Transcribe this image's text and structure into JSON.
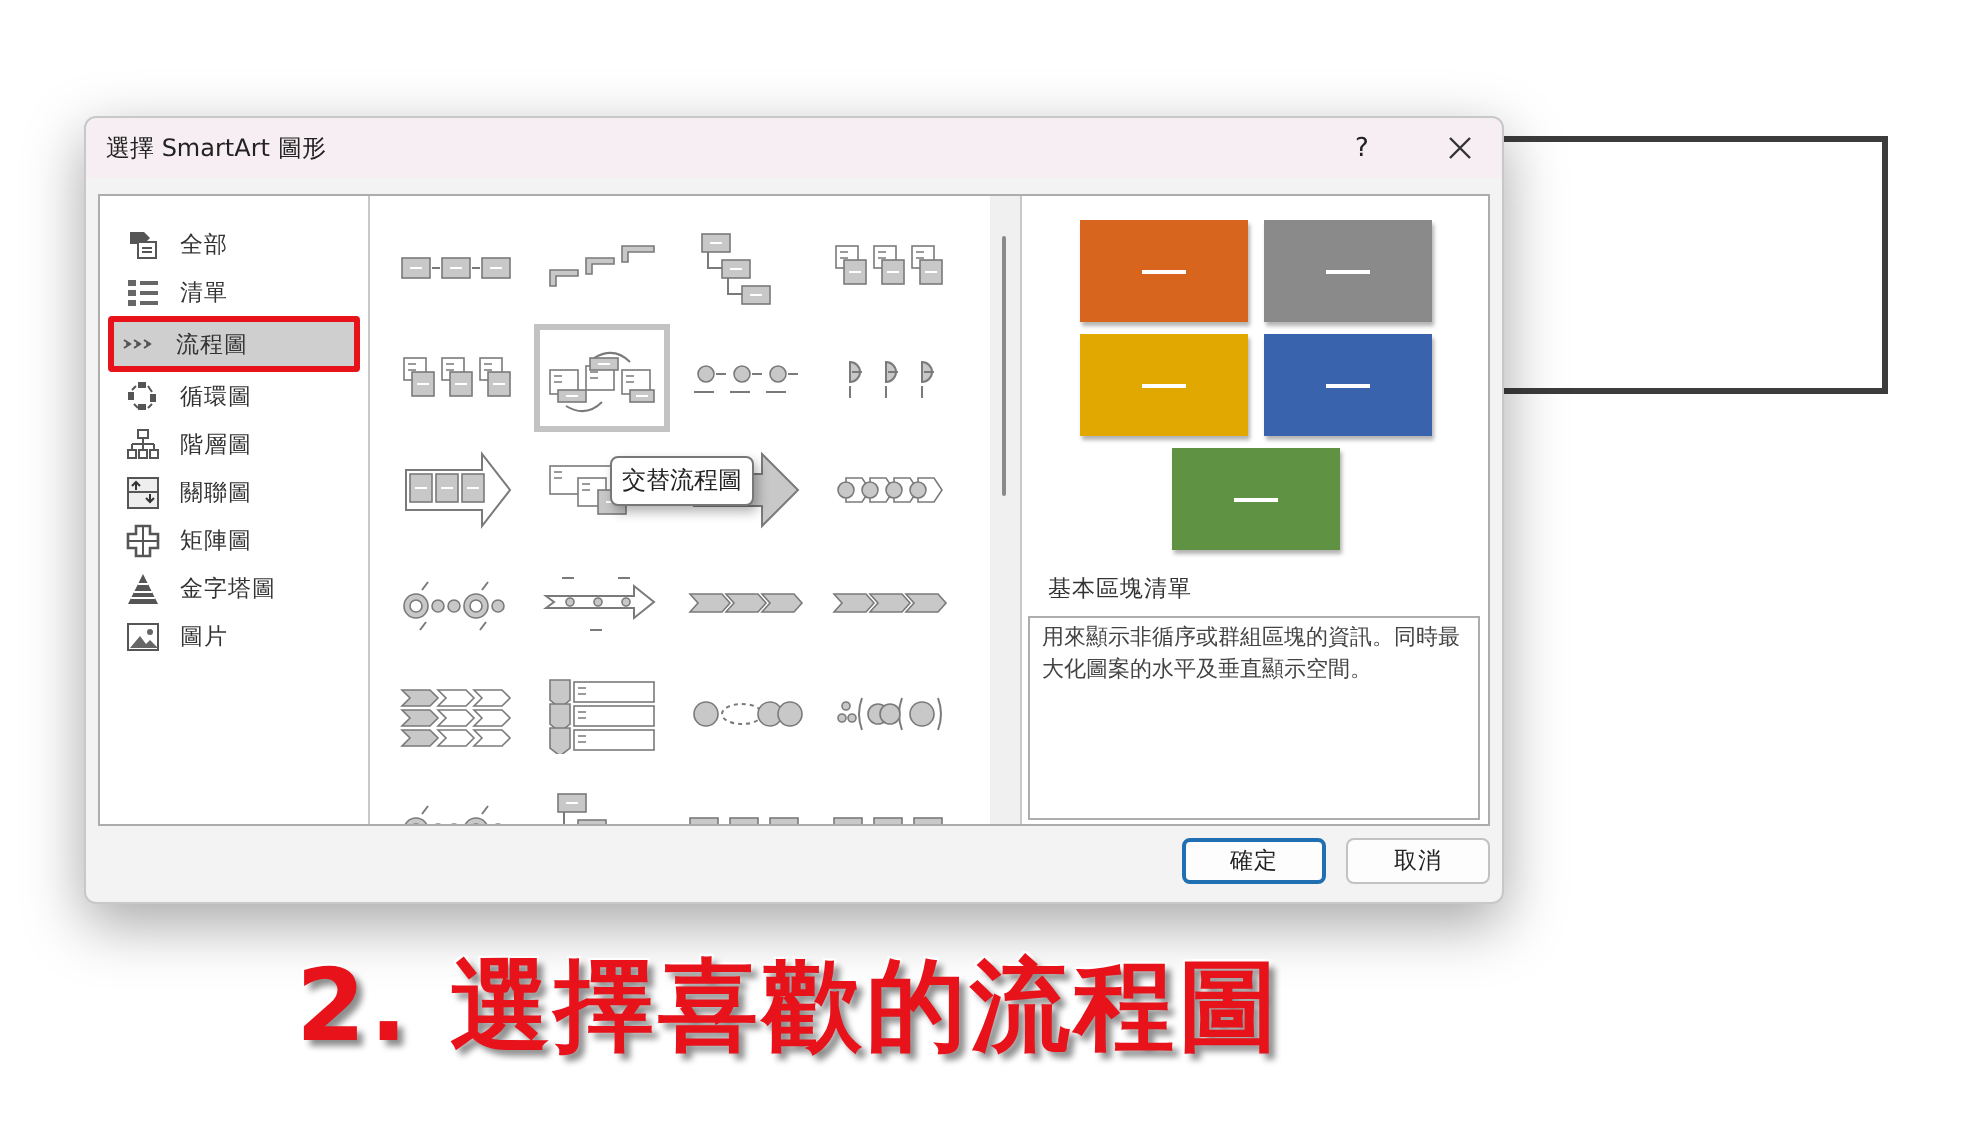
{
  "window": {
    "title": "選擇 SmartArt 圖形",
    "help": "?"
  },
  "categories": [
    {
      "label": "全部",
      "selected": false,
      "highlighted": false
    },
    {
      "label": "清單",
      "selected": false,
      "highlighted": false
    },
    {
      "label": "流程圖",
      "selected": true,
      "highlighted": true
    },
    {
      "label": "循環圖",
      "selected": false,
      "highlighted": false
    },
    {
      "label": "階層圖",
      "selected": false,
      "highlighted": false
    },
    {
      "label": "關聯圖",
      "selected": false,
      "highlighted": false
    },
    {
      "label": "矩陣圖",
      "selected": false,
      "highlighted": false
    },
    {
      "label": "金字塔圖",
      "selected": false,
      "highlighted": false
    },
    {
      "label": "圖片",
      "selected": false,
      "highlighted": false
    }
  ],
  "gallery": {
    "items": [
      {
        "kind": "blocks",
        "selected": false
      },
      {
        "kind": "steps",
        "selected": false
      },
      {
        "kind": "tree",
        "selected": false
      },
      {
        "kind": "cards",
        "selected": false
      },
      {
        "kind": "cards",
        "selected": false
      },
      {
        "kind": "alternating",
        "selected": true
      },
      {
        "kind": "dots",
        "selected": false
      },
      {
        "kind": "halfdots",
        "selected": false
      },
      {
        "kind": "arrow",
        "selected": false
      },
      {
        "kind": "stack",
        "selected": false
      },
      {
        "kind": "bigarrow",
        "selected": false
      },
      {
        "kind": "circlearrows",
        "selected": false
      },
      {
        "kind": "rings",
        "selected": false
      },
      {
        "kind": "timeline",
        "selected": false
      },
      {
        "kind": "chevrons",
        "selected": false
      },
      {
        "kind": "chevrons",
        "selected": false
      },
      {
        "kind": "chevronrows",
        "selected": false
      },
      {
        "kind": "vlist",
        "selected": false
      },
      {
        "kind": "circles",
        "selected": false
      },
      {
        "kind": "bubbles",
        "selected": false
      },
      {
        "kind": "rings",
        "selected": false
      },
      {
        "kind": "tree",
        "selected": false
      },
      {
        "kind": "blocks",
        "selected": false
      },
      {
        "kind": "blocks",
        "selected": false
      }
    ],
    "tooltip": "交替流程圖"
  },
  "preview": {
    "blocks": [
      {
        "color": "#d8651e"
      },
      {
        "color": "#8a8a8a"
      },
      {
        "color": "#e0a800"
      },
      {
        "color": "#3a63ad"
      },
      {
        "color": "#5f9343"
      }
    ],
    "title": "基本區塊清單",
    "description": "用來顯示非循序或群組區塊的資訊。同時最大化圖案的水平及垂直顯示空間。"
  },
  "buttons": [
    {
      "label": "確定",
      "default": true
    },
    {
      "label": "取消",
      "default": false
    }
  ],
  "caption": "2. 選擇喜歡的流程圖"
}
